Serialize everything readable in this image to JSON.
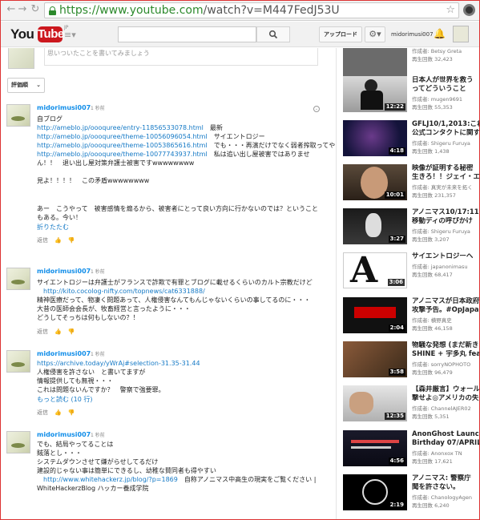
{
  "browser": {
    "url_host": "https://www.youtube.com",
    "url_path": "/watch?v=M447FedJ53U",
    "back_icon": "arrow-left",
    "forward_icon": "arrow-right",
    "reload_icon": "reload",
    "bookmark_icon": "star"
  },
  "header": {
    "logo_you": "You",
    "logo_tube": "Tube",
    "logo_region": "JP",
    "upload_label": "アップロード",
    "username": "midorimusi007"
  },
  "comments_section": {
    "share_placeholder": "思いついたことを書いてみましょう",
    "sort_label": "評価順"
  },
  "comments": [
    {
      "author": "midorimusi007",
      "time": "1 秒前",
      "lines": [
        {
          "text": "自ブログ",
          "link": ""
        },
        {
          "link": "http://ameblo.jp/oooquree/entry-11856533078.html",
          "text": "最新"
        },
        {
          "link": "http://ameblo.jp/oooquree/theme-10056096054.html",
          "text": "サイエントロジー"
        },
        {
          "link": "http://ameblo.jp/oooquree/theme-10053865616.html",
          "text": "でも・・・再演だけでなく弱者搾取ってやってる所多いのでは？人道を盾にして、という矛盾を書いた"
        },
        {
          "link": "http://ameblo.jp/oooquree/theme-10077743937.html",
          "text": "私は追い出し屋被害ではありませ"
        },
        {
          "link": "",
          "text": "ん！！　退い出し屋対策弁護士被害ですwwwwwwww"
        },
        {
          "link": "",
          "text": ""
        },
        {
          "link": "",
          "text": "見よ！！！！　この矛盾wwwwwwww"
        },
        {
          "link": "",
          "text": ""
        },
        {
          "link": "",
          "text": ""
        },
        {
          "link": "",
          "text": "あー　こうやって　被害感情を煽るから、被害者にとって良い方向に行かないのでは？ということ"
        },
        {
          "link": "",
          "text": "もある。今い！"
        }
      ],
      "more": "折りたたむ",
      "reply": "返信",
      "like_icon": "thumb-up",
      "dislike_icon": "thumb-down"
    },
    {
      "author": "midorimusi007",
      "time": "1 秒前",
      "lines": [
        {
          "link": "",
          "text": "サイエントロジーは弁護士がフランスで詐欺で有罪とブログに載せるくらいのカルト宗教だけど"
        },
        {
          "link": "http://kito.cocolog-nifty.com/topnews/cat6331888/",
          "text": ""
        },
        {
          "link": "",
          "text": "精神医療だって、物凄く問題あって、人権侵害なんてもんじゃないくらいの事してるのに・・・"
        },
        {
          "link": "",
          "text": "大昔の医師会会長が、牧畜経営と言ったように・・・"
        },
        {
          "link": "",
          "text": "どうしてそっちは何もしないの？！"
        }
      ],
      "reply": "返信"
    },
    {
      "author": "midorimusi007",
      "time": "1 秒前",
      "lines": [
        {
          "link": "https://archive.today/yWrAj#selection-31.35-31.44",
          "text": ""
        },
        {
          "link": "",
          "text": "人権侵害を許さない　と書いてますが"
        },
        {
          "link": "",
          "text": "情報提供しても無視・・・"
        },
        {
          "link": "",
          "text": "これは問題ないんですか？　警察で強要罪。"
        }
      ],
      "more": "もっと読む (10 行)",
      "reply": "返信"
    },
    {
      "author": "midorimusi007",
      "time": "1 秒前",
      "lines": [
        {
          "link": "",
          "text": "でも、結局やってることは"
        },
        {
          "link": "",
          "text": "賊落とし・・・"
        },
        {
          "link": "",
          "text": "システムダウンさせて嫌がらせしてるだけ"
        },
        {
          "link": "",
          "text": "建設的じゃない事は簡単にできるし、幼稚な賛同者も得やすい"
        },
        {
          "link": "http://www.whitehackerz.jp/blog/?p=1869",
          "text": "自称アノニマス中高生の現実をご覧ください |"
        },
        {
          "link": "",
          "text": "WhiteHackerzBlog ハッカー養成学院"
        }
      ]
    }
  ],
  "sidebar": {
    "videos": [
      {
        "title": "",
        "author": "作成者: Betsy Greta",
        "views": "再生回数 32,423",
        "duration": ""
      },
      {
        "title": "日本人が世界を救う",
        "title2": "ってどういうこと",
        "author": "作成者: mugen9691",
        "views": "再生回数 55,353",
        "duration": "12:22"
      },
      {
        "title": "GFLJ10/1,2013:これ",
        "title2": "公式コンタクトに関する",
        "author": "作成者: Shigeru Furuya",
        "views": "再生回数 1,438",
        "duration": "4:18"
      },
      {
        "title": "映像が証明する秘密",
        "title2": "生きろ！！ジェイ・エセ",
        "author": "作成者: 真実が未来を拓く",
        "views": "再生回数 231,357",
        "duration": "10:01"
      },
      {
        "title": "アノニマス10/17:11-",
        "title2": "移動ディの呼びかけ",
        "author": "作成者: Shigeru Furuya",
        "views": "再生回数 3,207",
        "duration": "3:27"
      },
      {
        "title": "サイエントロジーへ",
        "title2": "",
        "author": "作成者: japanonimasu",
        "views": "再生回数 68,417",
        "duration": "3:06"
      },
      {
        "title": "アノニマスが日本政府",
        "title2": "攻撃予告。#OpJapan",
        "author": "作成者: 横野真史",
        "views": "再生回数 46,158",
        "duration": "2:04"
      },
      {
        "title": "物騒な発想 (まだ新き",
        "title2": "SHINE + 宇多丸 feat",
        "author": "作成者: sorryNOPHOTO",
        "views": "再生回数 96,479",
        "duration": "3:58"
      },
      {
        "title": "【森井厳言】ウォール",
        "title2": "撃せよ◎アメリカの失",
        "author": "作成者: ChannelAJER02",
        "views": "再生回数 5,351",
        "duration": "12:35"
      },
      {
        "title": "AnonGhost Launch",
        "title2": "Birthday 07/APRIL/2",
        "author": "作成者: Anonxox TN",
        "views": "再生回数 17,621",
        "duration": "4:56"
      },
      {
        "title": "アノニマス:  警察庁",
        "title2": "聞を許さない。",
        "author": "作成者: ChanologyAgen",
        "views": "再生回数 6,240",
        "duration": "2:19"
      }
    ]
  }
}
